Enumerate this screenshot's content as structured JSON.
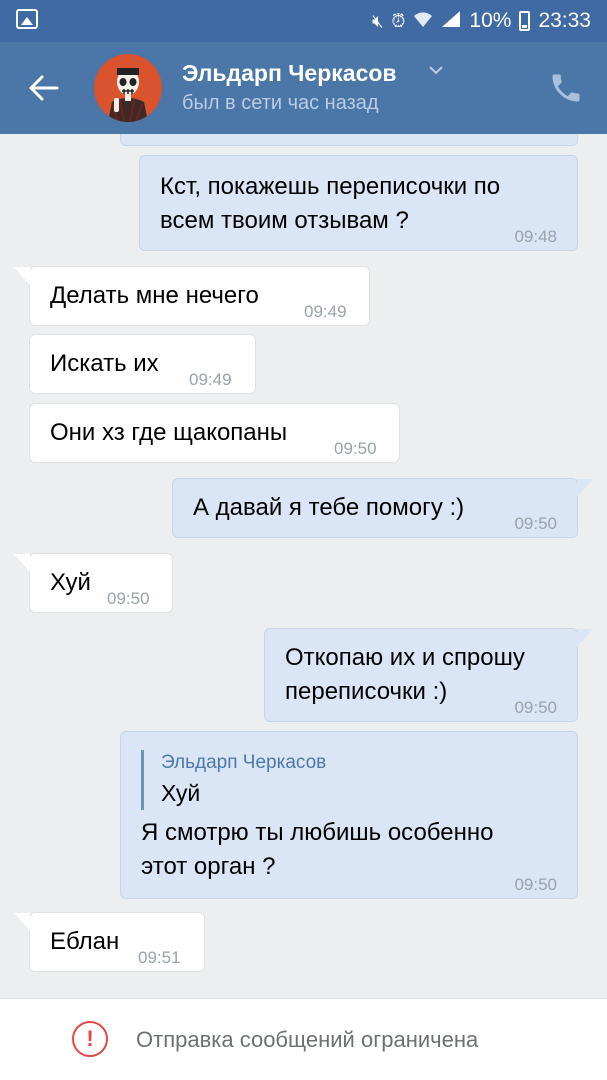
{
  "status_bar": {
    "battery": "10%",
    "time": "23:33"
  },
  "header": {
    "contact_name": "Эльдарп Черкасов",
    "last_seen": "был в сети час назад"
  },
  "messages": [
    {
      "direction": "out",
      "lines": [
        "Кст, покажешь переписочки по",
        "всем твоим отзывам ?"
      ],
      "time": "09:48"
    },
    {
      "direction": "in",
      "lines": [
        "Делать мне нечего"
      ],
      "time": "09:49"
    },
    {
      "direction": "in",
      "lines": [
        "Искать их"
      ],
      "time": "09:49"
    },
    {
      "direction": "in",
      "lines": [
        "Они хз где щакопаны"
      ],
      "time": "09:50"
    },
    {
      "direction": "out",
      "lines": [
        "А давай я тебе помогу :)"
      ],
      "time": "09:50"
    },
    {
      "direction": "in",
      "lines": [
        "Хуй"
      ],
      "time": "09:50"
    },
    {
      "direction": "out",
      "lines": [
        "Откопаю их и спрошу",
        "переписочки :)"
      ],
      "time": "09:50"
    },
    {
      "direction": "out",
      "reply": {
        "author": "Эльдарп Черкасов",
        "text": "Хуй"
      },
      "lines": [
        "Я смотрю ты любишь особенно",
        "этот орган ?"
      ],
      "time": "09:50"
    },
    {
      "direction": "in",
      "lines": [
        "Еблан"
      ],
      "time": "09:51"
    }
  ],
  "bottom_bar": {
    "notice": "Отправка сообщений ограничена"
  },
  "colors": {
    "header": "#4a76a8",
    "status_bar": "#3f6aa3",
    "outgoing_bubble": "#dae6f5",
    "incoming_bubble": "#ffffff",
    "chat_background": "#edeef0",
    "warning": "#e64646"
  }
}
